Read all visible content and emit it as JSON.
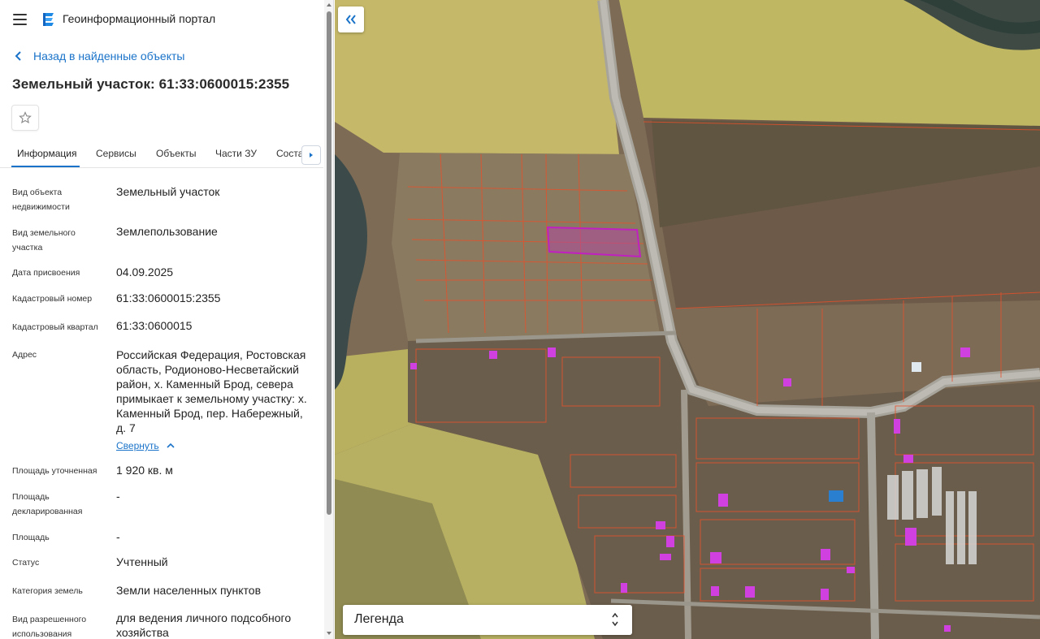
{
  "app": {
    "title": "Геоинформационный портал"
  },
  "nav": {
    "back_label": "Назад в найденные объекты"
  },
  "page": {
    "title": "Земельный участок: 61:33:0600015:2355"
  },
  "tabs": [
    {
      "label": "Информация",
      "active": true
    },
    {
      "label": "Сервисы"
    },
    {
      "label": "Объекты"
    },
    {
      "label": "Части ЗУ"
    },
    {
      "label": "Соста"
    }
  ],
  "properties": {
    "type_label": "Вид объекта недвижимости",
    "type_value": "Земельный участок",
    "land_kind_label": "Вид земельного участка",
    "land_kind_value": "Землепользование",
    "date_label": "Дата присвоения",
    "date_value": "04.09.2025",
    "cadastral_label": "Кадастровый номер",
    "cadastral_value": "61:33:0600015:2355",
    "quarter_label": "Кадастровый квартал",
    "quarter_value": "61:33:0600015",
    "address_label": "Адрес",
    "address_value": "Российская Федерация, Ростовская область, Родионово-Несветайский район, х. Каменный Брод, севера примыкает к земельному участку: х. Каменный Брод, пер. Набережный, д. 7",
    "collapse_label": "Свернуть",
    "area_label": "Площадь уточненная",
    "area_value": "1 920 кв. м",
    "declared_label": "Площадь декларированная",
    "declared_value": "-",
    "area2_label": "Площадь",
    "area2_value": "-",
    "status_label": "Статус",
    "status_value": "Учтенный",
    "category_label": "Категория земель",
    "category_value": "Земли населенных пунктов",
    "permitted_label": "Вид разрешенного использования",
    "permitted_value": "для ведения личного подсобного хозяйства"
  },
  "map": {
    "legend_label": "Легенда"
  },
  "colors": {
    "accent": "#1a73c9",
    "selected_parcel": "#c020c0",
    "parcel_border": "#e8502a",
    "zone_yellow": "#e8e27a"
  }
}
